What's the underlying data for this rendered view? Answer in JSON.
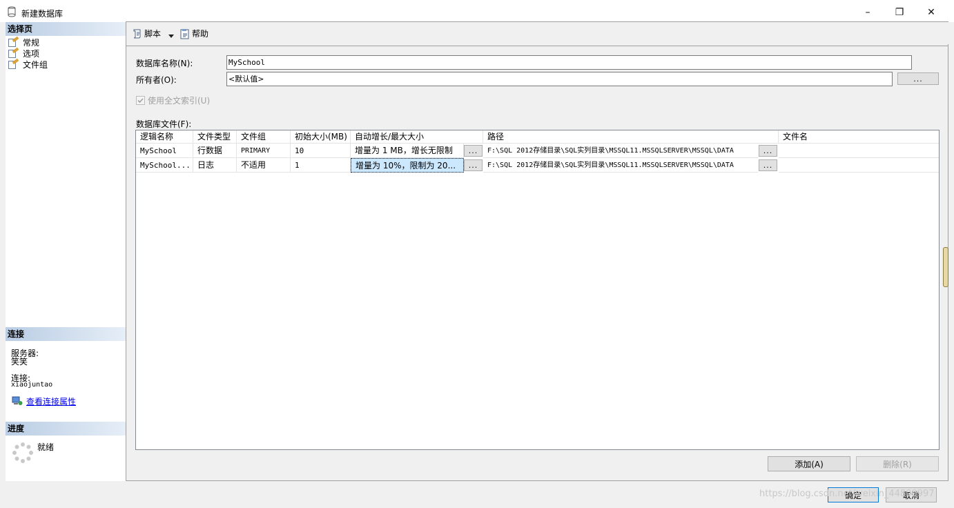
{
  "window": {
    "title": "新建数据库",
    "minimize": "–",
    "maximize": "❐",
    "close": "✕"
  },
  "sidebar": {
    "select_page_header": "选择页",
    "pages": [
      {
        "label": "常规"
      },
      {
        "label": "选项"
      },
      {
        "label": "文件组"
      }
    ],
    "connection_header": "连接",
    "server_label": "服务器:",
    "server_value": "笑笑",
    "connection_label": "连接:",
    "connection_value": "xiaojuntao",
    "view_props_link": "查看连接属性",
    "progress_header": "进度",
    "progress_status": "就绪"
  },
  "toolbar": {
    "script_label": "脚本",
    "help_label": "帮助"
  },
  "form": {
    "db_name_label": "数据库名称(N):",
    "db_name_value": "MySchool",
    "owner_label": "所有者(O):",
    "owner_value": "<默认值>",
    "owner_browse": "...",
    "fulltext_label": "使用全文索引(U)",
    "db_files_label": "数据库文件(F):"
  },
  "grid": {
    "columns": [
      "逻辑名称",
      "文件类型",
      "文件组",
      "初始大小(MB)",
      "自动增长/最大大小",
      "路径",
      "文件名"
    ],
    "rows": [
      {
        "logical": "MySchool",
        "type": "行数据",
        "filegroup": "PRIMARY",
        "size": "10",
        "growth": "增量为 1 MB，增长无限制",
        "growth_btn": "...",
        "path": "F:\\SQL 2012存储目录\\SQL实列目录\\MSSQL11.MSSQLSERVER\\MSSQL\\DATA",
        "path_btn": "...",
        "filename": ""
      },
      {
        "logical": "MySchool...",
        "type": "日志",
        "filegroup": "不适用",
        "size": "1",
        "growth": "增量为 10%，限制为 20...",
        "growth_btn": "...",
        "path": "F:\\SQL 2012存储目录\\SQL实列目录\\MSSQL11.MSSQLSERVER\\MSSQL\\DATA",
        "path_btn": "...",
        "filename": ""
      }
    ]
  },
  "buttons": {
    "add": "添加(A)",
    "remove": "删除(R)",
    "ok": "确定",
    "cancel": "取消"
  },
  "watermark": "https://blog.csdn.net/weixin_44800997"
}
